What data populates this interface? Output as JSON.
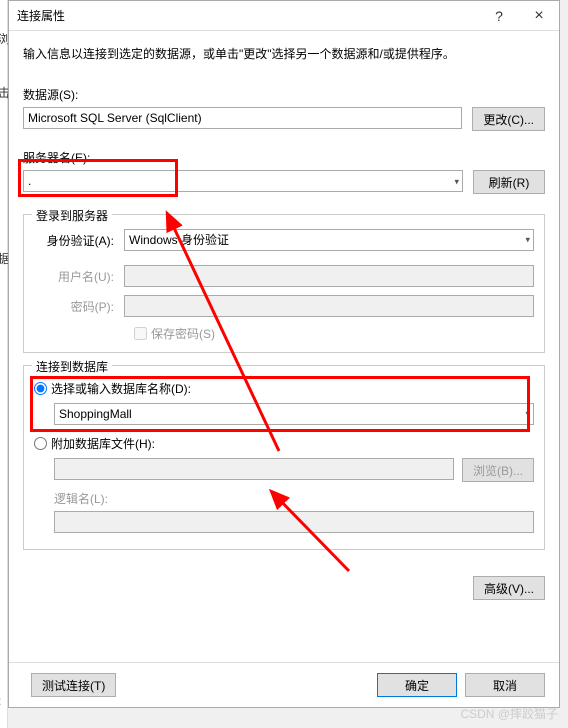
{
  "title": "连接属性",
  "instruction": "输入信息以连接到选定的数据源，或单击\"更改\"选择另一个数据源和/或提供程序。",
  "datasource": {
    "label": "数据源(S):",
    "value": "Microsoft SQL Server (SqlClient)",
    "change_btn": "更改(C)..."
  },
  "server": {
    "label": "服务器名(E):",
    "value": ".",
    "refresh_btn": "刷新(R)"
  },
  "login": {
    "legend": "登录到服务器",
    "auth_label": "身份验证(A):",
    "auth_value": "Windows 身份验证",
    "username_label": "用户名(U):",
    "username_value": "",
    "password_label": "密码(P):",
    "password_value": "",
    "save_password": "保存密码(S)"
  },
  "database": {
    "legend": "连接到数据库",
    "select_radio": "选择或输入数据库名称(D):",
    "select_value": "ShoppingMall",
    "attach_radio": "附加数据库文件(H):",
    "attach_value": "",
    "browse_btn": "浏览(B)...",
    "logical_label": "逻辑名(L):",
    "logical_value": ""
  },
  "advanced_btn": "高级(V)...",
  "footer": {
    "test_btn": "测试连接(T)",
    "ok_btn": "确定",
    "cancel_btn": "取消"
  },
  "watermark": "CSDN @摔跤猫子"
}
